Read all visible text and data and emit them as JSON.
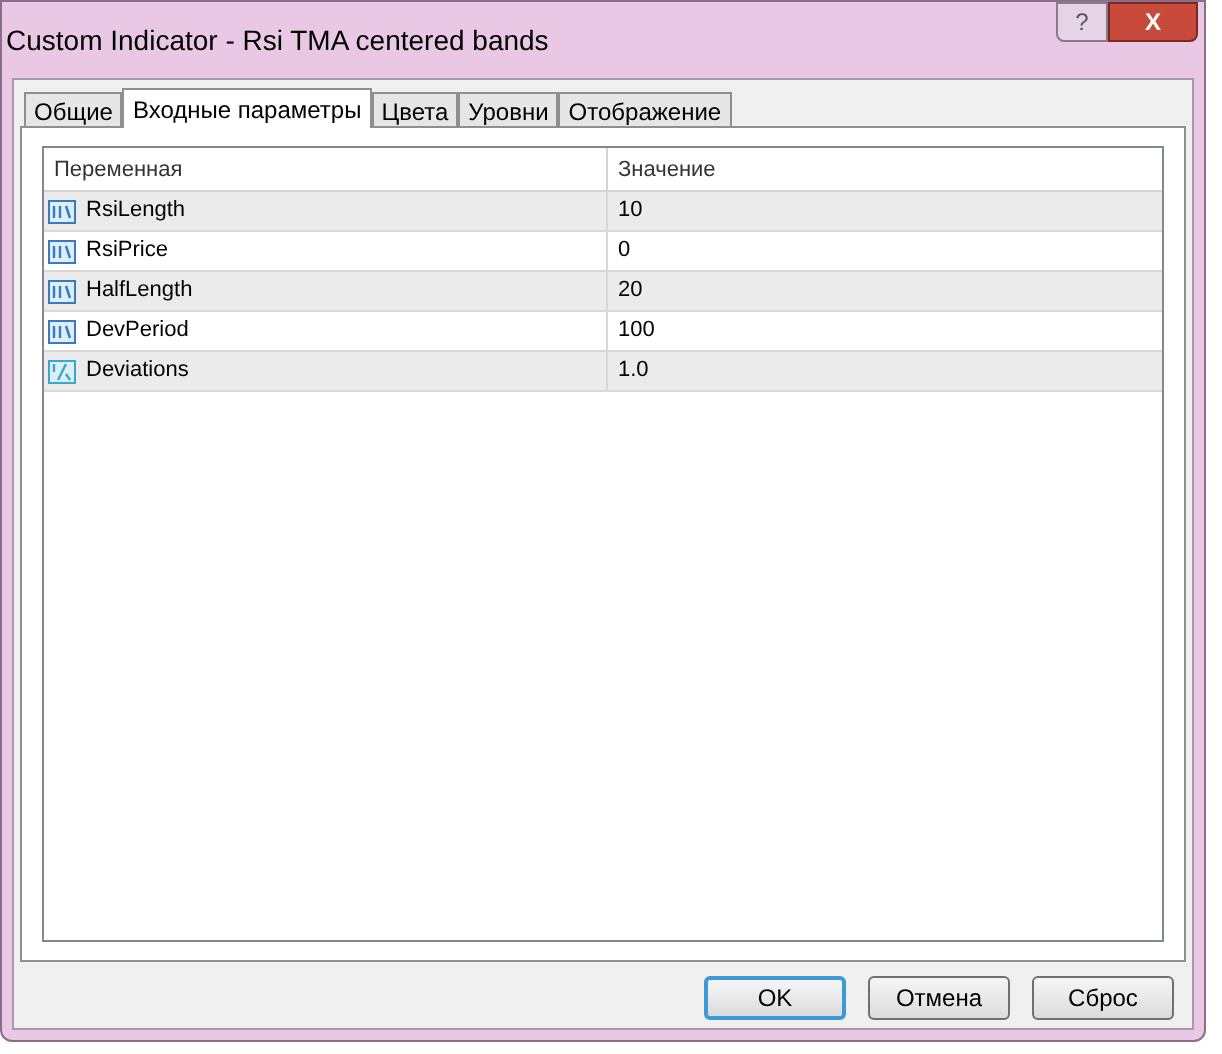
{
  "window": {
    "title": "Custom Indicator - Rsi  TMA centered  bands",
    "help": "?",
    "close": "X"
  },
  "tabs": [
    {
      "label": "Общие",
      "selected": false
    },
    {
      "label": "Входные параметры",
      "selected": true
    },
    {
      "label": "Цвета",
      "selected": false
    },
    {
      "label": "Уровни",
      "selected": false
    },
    {
      "label": "Отображение",
      "selected": false
    }
  ],
  "table": {
    "columns": [
      "Переменная",
      "Значение"
    ],
    "rows": [
      {
        "kind": "integer",
        "name": "RsiLength",
        "value": "10"
      },
      {
        "kind": "integer",
        "name": "RsiPrice",
        "value": "0"
      },
      {
        "kind": "integer",
        "name": "HalfLength",
        "value": "20"
      },
      {
        "kind": "integer",
        "name": "DevPeriod",
        "value": "100"
      },
      {
        "kind": "double",
        "name": "Deviations",
        "value": "1.0"
      }
    ]
  },
  "buttons": [
    {
      "label": "OK",
      "selected": true
    },
    {
      "label": "Отмена",
      "selected": false
    },
    {
      "label": "Сброс",
      "selected": false
    }
  ]
}
